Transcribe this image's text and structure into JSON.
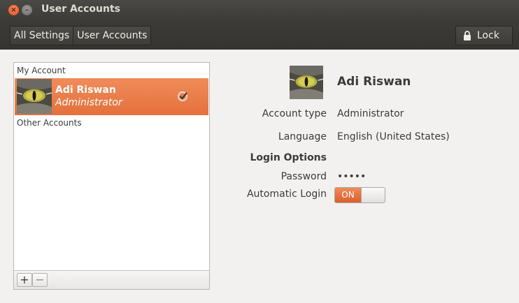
{
  "window": {
    "title": "User Accounts"
  },
  "toolbar": {
    "breadcrumbs": [
      "All Settings",
      "User Accounts"
    ],
    "lock_label": "Lock"
  },
  "list": {
    "my_account_label": "My Account",
    "selected_user": {
      "name": "Adi Riswan",
      "role": "Administrator"
    },
    "other_accounts_label": "Other Accounts",
    "add_label": "+",
    "remove_label": "−"
  },
  "details": {
    "name": "Adi Riswan",
    "account_type_label": "Account type",
    "account_type_value": "Administrator",
    "language_label": "Language",
    "language_value": "English (United States)",
    "login_options_header": "Login Options",
    "password_label": "Password",
    "password_value": "•••••",
    "auto_login_label": "Automatic Login",
    "auto_login_state": "ON"
  },
  "colors": {
    "accent": "#e5703c",
    "titlebar": "#3c3b37"
  },
  "icons": {
    "close": "close-icon",
    "minimize": "minimize-icon",
    "lock": "lock-icon",
    "current_user": "check-circle-icon",
    "avatar": "cat-eye-avatar"
  }
}
